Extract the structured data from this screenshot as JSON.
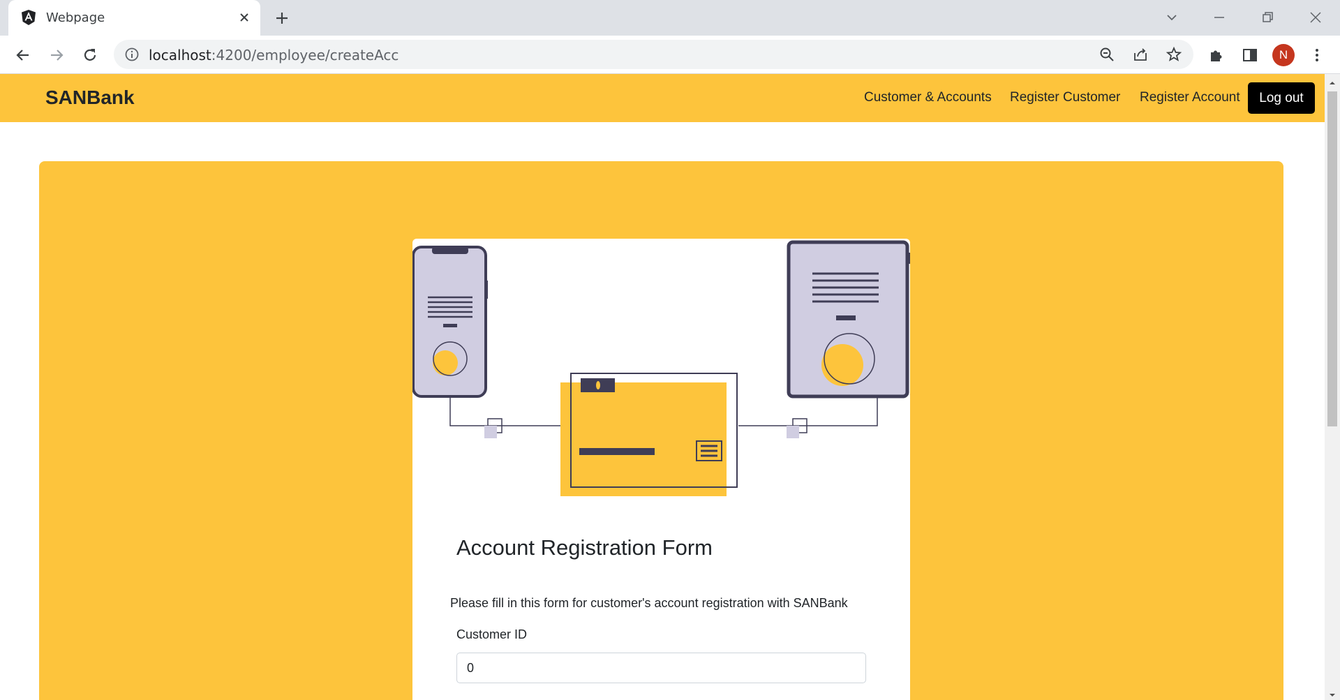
{
  "browser": {
    "tab_title": "Webpage",
    "url_host": "localhost",
    "url_path": ":4200/employee/createAcc",
    "profile_initial": "N"
  },
  "navbar": {
    "brand": "SANBank",
    "links": [
      "Customer & Accounts",
      "Register Customer",
      "Register Account"
    ],
    "logout_label": "Log out"
  },
  "form": {
    "title": "Account Registration Form",
    "description": "Please fill in this form for customer's account registration with SANBank",
    "customer_id_label": "Customer ID",
    "customer_id_value": "0"
  },
  "colors": {
    "accent": "#fdc43c",
    "device": "#3f3d56",
    "device_fill": "#d0cde1"
  }
}
